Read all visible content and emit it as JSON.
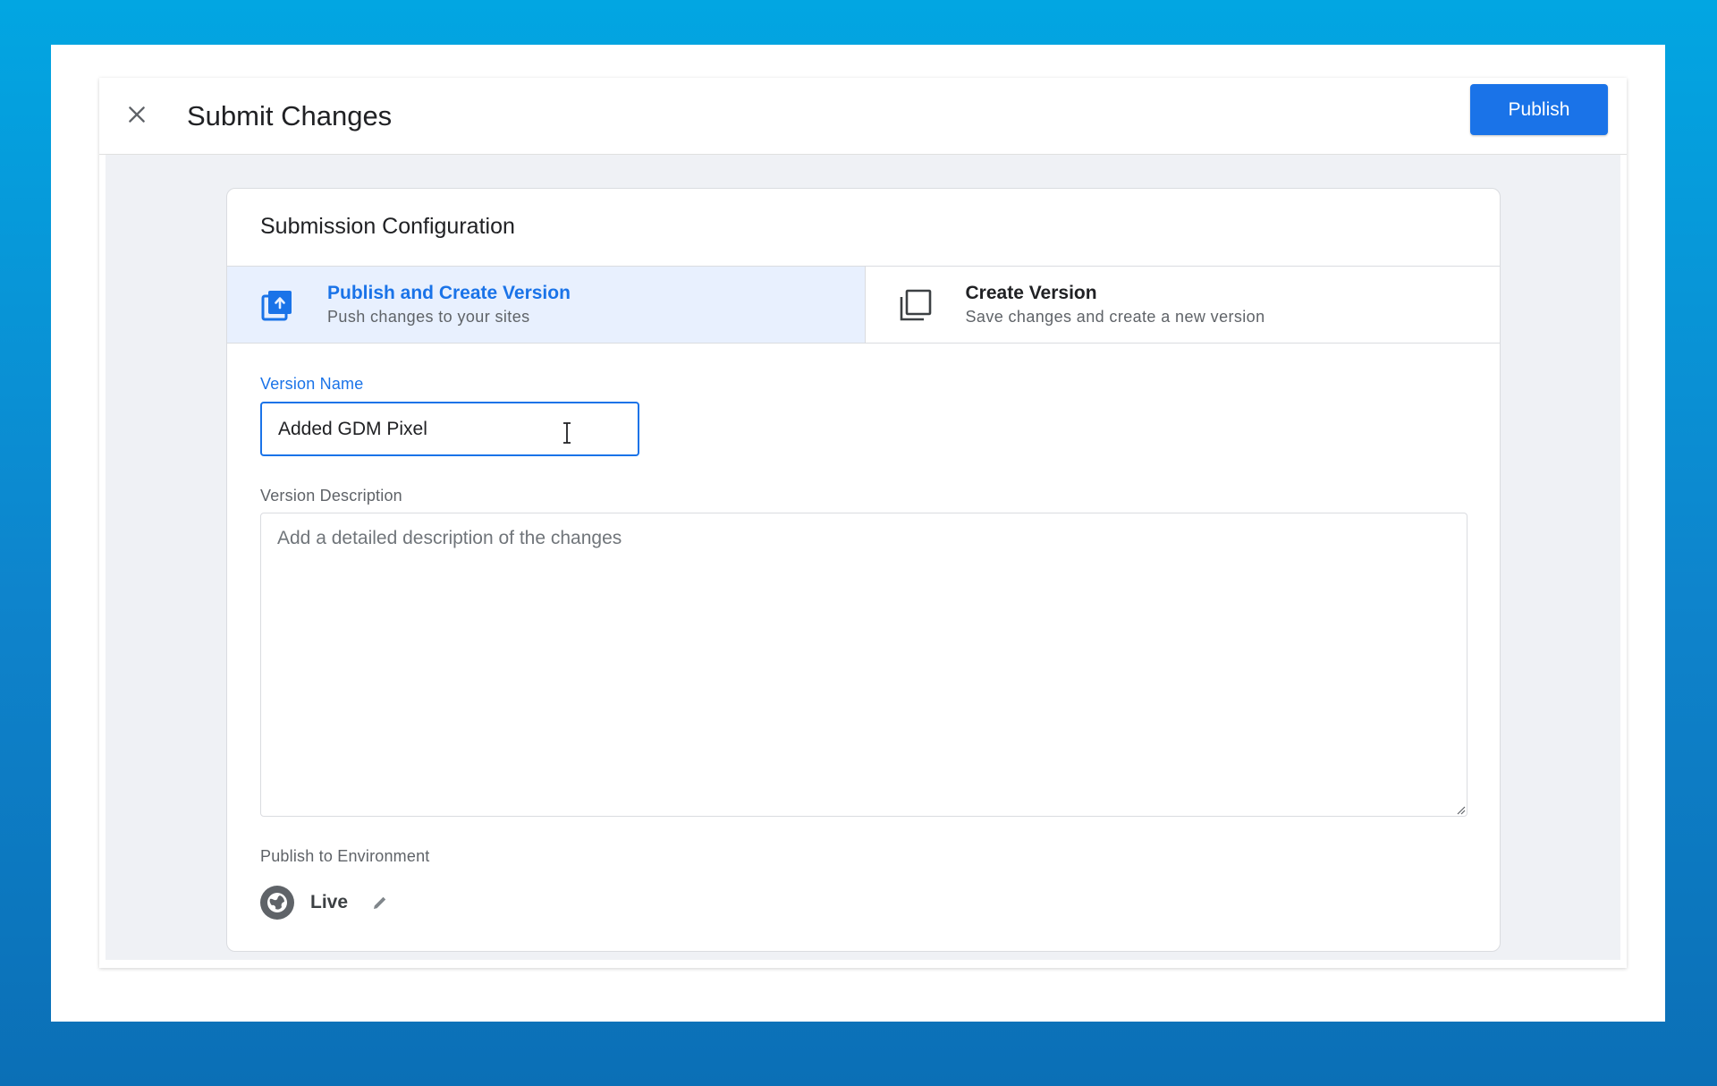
{
  "header": {
    "title": "Submit Changes",
    "publish_label": "Publish"
  },
  "card": {
    "title": "Submission Configuration",
    "options": [
      {
        "title": "Publish and Create Version",
        "subtitle": "Push changes to your sites",
        "icon": "publish-upload-icon",
        "selected": true
      },
      {
        "title": "Create Version",
        "subtitle": "Save changes and create a new version",
        "icon": "copy-version-icon",
        "selected": false
      }
    ]
  },
  "form": {
    "version_name_label": "Version Name",
    "version_name_value": "Added GDM Pixel",
    "version_description_label": "Version Description",
    "version_description_placeholder": "Add a detailed description of the changes",
    "environment_label": "Publish to Environment",
    "environment_name": "Live",
    "environment_icon": "globe-icon"
  },
  "colors": {
    "accent": "#1a73e8",
    "selected_option_bg": "#e8f0fe",
    "body_bg": "#eff1f5"
  }
}
